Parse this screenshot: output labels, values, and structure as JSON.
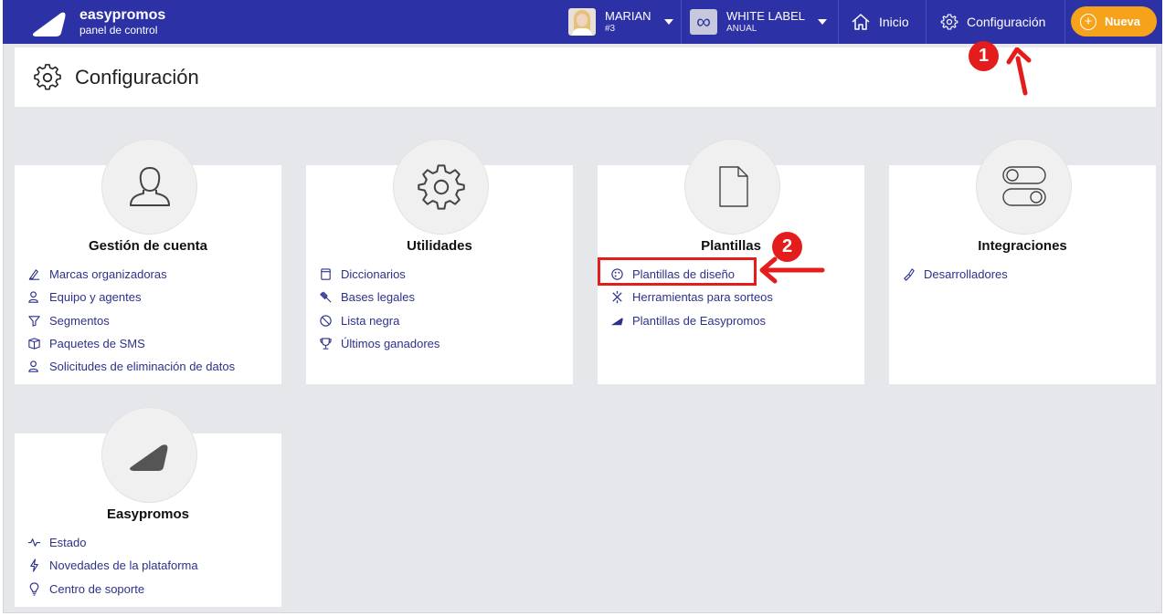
{
  "topbar": {
    "brand_name": "easypromos",
    "brand_sub": "panel de control",
    "user_name": "MARIAN",
    "user_id": "#3",
    "plan_name": "WHITE LABEL",
    "plan_period": "ANUAL",
    "home_label": "Inicio",
    "config_label": "Configuración",
    "new_label": "Nueva",
    "accent": "#2d31a6",
    "new_color": "#f7a21b"
  },
  "page": {
    "title": "Configuración"
  },
  "cards": [
    {
      "title": "Gestión de cuenta",
      "icon": "user-icon",
      "links": [
        {
          "label": "Marcas organizadoras",
          "icon": "brand-icon"
        },
        {
          "label": "Equipo y agentes",
          "icon": "users-icon"
        },
        {
          "label": "Segmentos",
          "icon": "filter-icon"
        },
        {
          "label": "Paquetes de SMS",
          "icon": "package-icon"
        },
        {
          "label": "Solicitudes de eliminación de datos",
          "icon": "user-delete-icon"
        }
      ]
    },
    {
      "title": "Utilidades",
      "icon": "gear-icon",
      "links": [
        {
          "label": "Diccionarios",
          "icon": "dictionary-icon"
        },
        {
          "label": "Bases legales",
          "icon": "gavel-icon"
        },
        {
          "label": "Lista negra",
          "icon": "blocked-icon"
        },
        {
          "label": "Últimos ganadores",
          "icon": "trophy-icon"
        }
      ]
    },
    {
      "title": "Plantillas",
      "icon": "document-icon",
      "links": [
        {
          "label": "Plantillas de diseño",
          "icon": "palette-icon"
        },
        {
          "label": "Herramientas para sorteos",
          "icon": "tools-icon"
        },
        {
          "label": "Plantillas de Easypromos",
          "icon": "easypromos-icon"
        }
      ]
    },
    {
      "title": "Integraciones",
      "icon": "toggles-icon",
      "links": [
        {
          "label": "Desarrolladores",
          "icon": "developer-icon"
        }
      ]
    },
    {
      "title": "Easypromos",
      "icon": "easypromos-logo-icon",
      "links": [
        {
          "label": "Estado",
          "icon": "pulse-icon"
        },
        {
          "label": "Novedades de la plataforma",
          "icon": "bolt-icon"
        },
        {
          "label": "Centro de soporte",
          "icon": "lightbulb-icon"
        }
      ]
    }
  ],
  "annotations": [
    {
      "label": "1",
      "color": "#e51c1c"
    },
    {
      "label": "2",
      "color": "#e51c1c"
    }
  ]
}
